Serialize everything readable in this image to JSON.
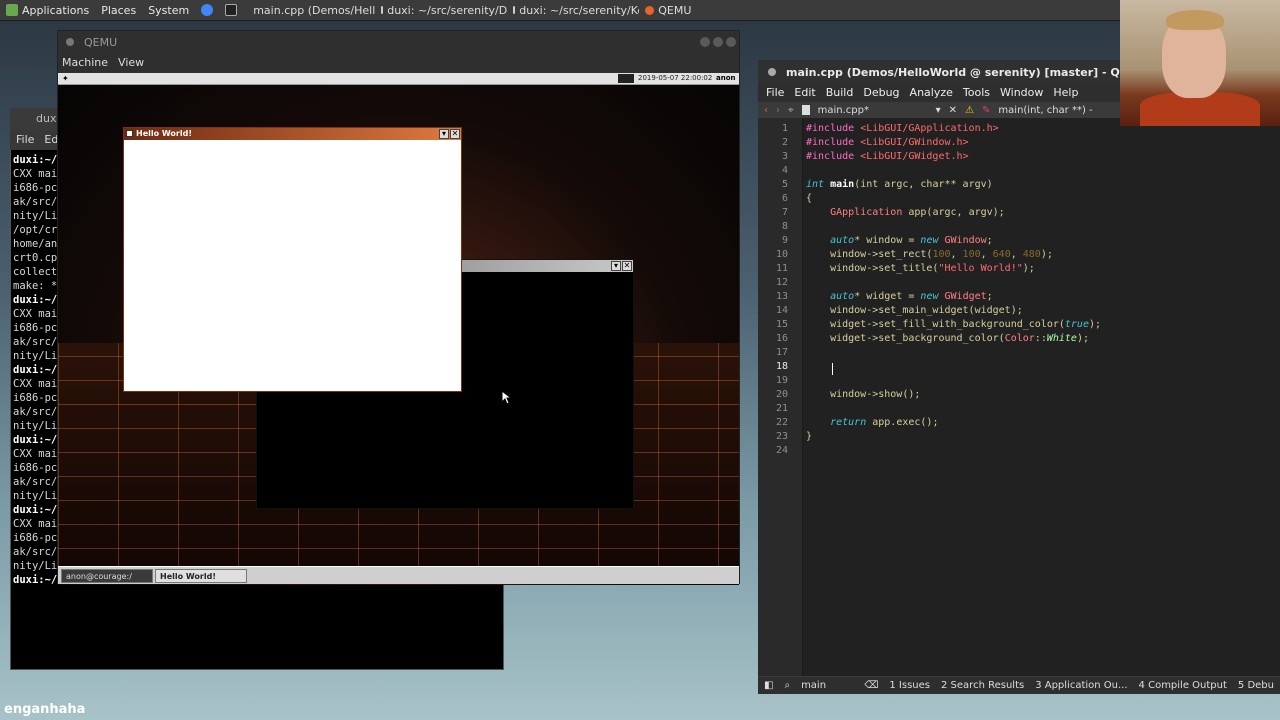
{
  "panel": {
    "menus": [
      "Applications",
      "Places",
      "System"
    ],
    "tasks": [
      "main.cpp (Demos/Hell...",
      "duxi: ~/src/serenity/De...",
      "duxi: ~/src/serenity/Ke...",
      "QEMU"
    ]
  },
  "terminal": {
    "title": "duxi",
    "menu": [
      "File",
      "Edi"
    ],
    "lines": [
      {
        "t": "duxi:~/",
        "p": true
      },
      {
        "t": "CXX mai",
        "p": false
      },
      {
        "t": "i686-pc",
        "p": false
      },
      {
        "t": "ak/src/",
        "p": false
      },
      {
        "t": "nity/Li",
        "p": false
      },
      {
        "t": "/opt/cr",
        "p": false
      },
      {
        "t": "home/an",
        "p": false
      },
      {
        "t": "crt0.cp",
        "p": false
      },
      {
        "t": "collect",
        "p": false
      },
      {
        "t": "make: *",
        "p": false
      },
      {
        "t": "duxi:~/",
        "p": true
      },
      {
        "t": "CXX mai",
        "p": false
      },
      {
        "t": "i686-pc",
        "p": false
      },
      {
        "t": "ak/src/",
        "p": false
      },
      {
        "t": "nity/Li",
        "p": false
      },
      {
        "t": "duxi:~/",
        "p": true
      },
      {
        "t": "CXX mai",
        "p": false
      },
      {
        "t": "i686-pc",
        "p": false
      },
      {
        "t": "ak/src/",
        "p": false
      },
      {
        "t": "nity/Li",
        "p": false
      },
      {
        "t": "duxi:~/",
        "p": true
      },
      {
        "t": "CXX mai",
        "p": false
      },
      {
        "t": "i686-pc",
        "p": false
      },
      {
        "t": "ak/src/",
        "p": false
      },
      {
        "t": "nity/Li",
        "p": false
      },
      {
        "t": "duxi:~/",
        "p": true
      },
      {
        "t": "CXX mai",
        "p": false
      },
      {
        "t": "i686-pc",
        "p": false
      },
      {
        "t": "ak/src/",
        "p": false
      },
      {
        "t": "nity/Li",
        "p": false
      },
      {
        "t": "duxi:~/",
        "p": true
      }
    ]
  },
  "qemu": {
    "title": "QEMU",
    "menu": [
      "Machine",
      "View"
    ],
    "guest": {
      "clock": "2019-05-07 22:00:02",
      "user": "anon",
      "hello_title": "Hello World!",
      "taskbar": [
        "anon@courage:/",
        "Hello World!"
      ]
    }
  },
  "qt": {
    "title": "main.cpp (Demos/HelloWorld @ serenity) [master] - Qt Creator",
    "menu": [
      "File",
      "Edit",
      "Build",
      "Debug",
      "Analyze",
      "Tools",
      "Window",
      "Help"
    ],
    "tab_file": "main.cpp*",
    "tab_symbol": "main(int, char **) -",
    "current_line": 18,
    "status": {
      "target": "main",
      "panes": [
        "1 Issues",
        "2 Search Results",
        "3 Application Ou...",
        "4 Compile Output",
        "5 Debu"
      ]
    }
  },
  "watermark": "enganhaha"
}
